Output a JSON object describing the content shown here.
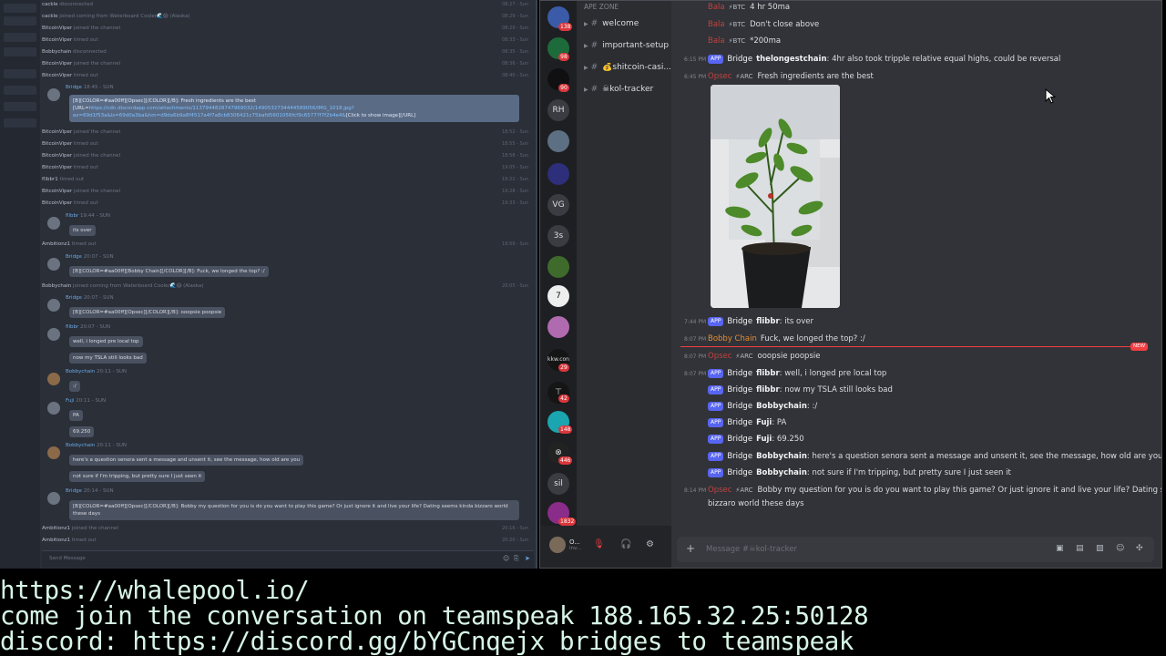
{
  "left": {
    "rows": [
      {
        "name": "cackle",
        "action": "disconnected",
        "time": "08:27 - Sun"
      },
      {
        "name": "cackle",
        "action": "joined coming from Waterboard Cooler🌊😱 (Alaska)",
        "time": "08:29 - Sun"
      },
      {
        "name": "BitcoinViper",
        "action": "joined the channel",
        "time": "08:29 - Sun"
      },
      {
        "name": "BitcoinViper",
        "action": "timed out",
        "time": "08:33 - Sun"
      },
      {
        "name": "Bobbychain",
        "action": "disconnected",
        "time": "08:35 - Sun"
      },
      {
        "name": "BitcoinViper",
        "action": "joined the channel",
        "time": "08:36 - Sun"
      },
      {
        "name": "BitcoinViper",
        "action": "timed out",
        "time": "08:40 - Sun"
      }
    ],
    "rows2": [
      {
        "name": "BitcoinViper",
        "action": "joined the channel",
        "time": "18:52 - Sun"
      },
      {
        "name": "BitcoinViper",
        "action": "timed out",
        "time": "18:55 - Sun"
      },
      {
        "name": "BitcoinViper",
        "action": "joined the channel",
        "time": "18:58 - Sun"
      },
      {
        "name": "BitcoinViper",
        "action": "timed out",
        "time": "19:05 - Sun"
      },
      {
        "name": "flibbr1",
        "action": "timed out",
        "time": "19:22 - Sun"
      },
      {
        "name": "BitcoinViper",
        "action": "joined the channel",
        "time": "19:28 - Sun"
      },
      {
        "name": "BitcoinViper",
        "action": "timed out",
        "time": "19:33 - Sun"
      }
    ],
    "bridge1_author": "Bridge",
    "bridge1_time": "18:45 - SUN",
    "bridge1_line1": "[B][COLOR=#aa00ff][Opsec][/COLOR][/B]: Fresh ingredients are the best",
    "bridge1_line2a": "[URL=",
    "bridge1_line2b": "https://cdn.discordapp.com/attachments/1137944828747969032/1490532734444589056/IMG_1018.jpg?",
    "bridge1_line3": "ex=69d1f53a&is=69d0a3ba&hm=d9da6b9a8f4517a4f7a8cb8306421c75bafd5601056fcf9c6577?f7f2b4e4&",
    "bridge1_line3b": "[Click to show image]",
    "bridge1_line3c": "[/URL]",
    "flibbr_author": "flibbr",
    "flibbr_time": "19:44 - SUN",
    "flibbr_msg": "its over",
    "amb_row": {
      "name": "Ambitionz1",
      "action": "timed out",
      "time": "19:59 - Sun"
    },
    "bridge2_author": "Bridge",
    "bridge2_time": "20:07 - SUN",
    "bridge2_msg": "[B][COLOR=#aa00ff][Bobby Chain][/COLOR][/B]: Fuck, we longed the top? :/",
    "bobby_row": {
      "name": "Bobbychain",
      "action": "joined coming from Waterboard Cooler🌊😱 (Alaska)",
      "time": "20:05 - Sun"
    },
    "bridge3_author": "Bridge",
    "bridge3_time": "20:07 - SUN",
    "bridge3_msg": "[B][COLOR=#aa00ff][Opsec][/COLOR][/B]: ooopsie poopsie",
    "flibbr2_author": "flibbr",
    "flibbr2_time": "20:07 - SUN",
    "flibbr2_msg1": "well, i longed pre local top",
    "flibbr2_msg2": "now my TSLA still looks bad",
    "bc1_author": "Bobbychain",
    "bc1_time": "20:11 - SUN",
    "bc1_msg": ":/",
    "fuji_author": "Fuji",
    "fuji_time": "20:11 - SUN",
    "fuji_msg1": "PA",
    "fuji_msg2": "69.250",
    "bc2_author": "Bobbychain",
    "bc2_time": "20:11 - SUN",
    "bc2_msg1": "here's a question senora sent a message and unsent it, see the message, how old are you",
    "bc2_msg2": "not sure if I'm tripping, but pretty sure I just seen it",
    "bridge4_author": "Bridge",
    "bridge4_time": "20:14 - SUN",
    "bridge4_msg": "[B][COLOR=#aa00ff][Opsec][/COLOR][/B]: Bobby my question for you is do you want to play this game? Or just ignore it and live your life? Dating seems kinda bizzaro world these days",
    "tail_rows": [
      {
        "name": "Ambitionz1",
        "action": "joined the channel",
        "time": "20:16 - Sun"
      },
      {
        "name": "Ambitionz1",
        "action": "timed out",
        "time": "20:20 - Sun"
      }
    ],
    "input_placeholder": "Send Message"
  },
  "right": {
    "zone": "APE ZONE",
    "channels": [
      {
        "name": "welcome",
        "icon": "hash"
      },
      {
        "name": "important-setup",
        "icon": "hash"
      },
      {
        "name": "💰shitcoin-casi...",
        "icon": "hash"
      },
      {
        "name": "☠kol-tracker",
        "icon": "hash"
      }
    ],
    "servers": [
      {
        "label": "",
        "badge": "138"
      },
      {
        "label": "",
        "badge": "98"
      },
      {
        "label": "",
        "badge": "90"
      },
      {
        "label": "RH",
        "badge": ""
      },
      {
        "label": "",
        "badge": ""
      },
      {
        "label": "",
        "badge": ""
      },
      {
        "label": "VG",
        "badge": ""
      },
      {
        "label": "3s",
        "badge": ""
      },
      {
        "label": "",
        "badge": ""
      },
      {
        "label": "7",
        "badge": ""
      },
      {
        "label": "",
        "badge": ""
      },
      {
        "label": "",
        "badge": "29"
      },
      {
        "label": "",
        "badge": "42"
      },
      {
        "label": "",
        "badge": "148"
      },
      {
        "label": "",
        "badge": "446"
      },
      {
        "label": "sil",
        "badge": ""
      },
      {
        "label": "",
        "badge": "1832"
      }
    ],
    "user_name": "O...",
    "user_status": "inv...",
    "messages": {
      "a1": {
        "user": "Bala",
        "tag": "⚡BTC",
        "text": "4 hr 50ma"
      },
      "a2": {
        "user": "Bala",
        "tag": "⚡BTC",
        "text": "Don't close above"
      },
      "a3": {
        "user": "Bala",
        "tag": "⚡BTC",
        "text": "*200ma"
      },
      "b1": {
        "time": "6:15 PM",
        "app": "APP",
        "bridge": "Bridge",
        "name": "thelongestchain",
        "text": ": 4hr also took tripple relative equal highs, could be reversal"
      },
      "c1": {
        "time": "6:45 PM",
        "user": "Opsec",
        "tag": "⚡ARC",
        "text": "Fresh ingredients are the best"
      },
      "d1": {
        "time": "7:44 PM",
        "app": "APP",
        "bridge": "Bridge",
        "name": "flibbr",
        "text": ": its over"
      },
      "e1": {
        "time": "8:07 PM",
        "user": "Bobby Chain",
        "text": "Fuck, we longed the top? :/"
      },
      "f1": {
        "time": "8:07 PM",
        "user": "Opsec",
        "tag": "⚡ARC",
        "text": "ooopsie poopsie"
      },
      "g1": {
        "time": "8:07 PM",
        "app": "APP",
        "bridge": "Bridge",
        "name": "flibbr",
        "text": ": well, i longed pre local top"
      },
      "g2": {
        "app": "APP",
        "bridge": "Bridge",
        "name": "flibbr",
        "text": ": now my TSLA still looks bad"
      },
      "g3": {
        "app": "APP",
        "bridge": "Bridge",
        "name": "Bobbychain",
        "text": ": :/"
      },
      "g4": {
        "app": "APP",
        "bridge": "Bridge",
        "name": "Fuji",
        "text": ": PA"
      },
      "g5": {
        "app": "APP",
        "bridge": "Bridge",
        "name": "Fuji",
        "text": ": 69.250"
      },
      "g6": {
        "app": "APP",
        "bridge": "Bridge",
        "name": "Bobbychain",
        "text": ": here's a question senora sent a message and unsent it, see the message, how old are you"
      },
      "g7": {
        "app": "APP",
        "bridge": "Bridge",
        "name": "Bobbychain",
        "text": ": not sure if I'm tripping, but pretty sure I just seen it"
      },
      "h1": {
        "time": "8:14 PM",
        "user": "Opsec",
        "tag": "⚡ARC",
        "text": "Bobby my question for you is do you want to play this game? Or just ignore it and live your life? Dating seems kinda",
        "text2": "bizzaro world these days"
      }
    },
    "new_badge": "NEW",
    "composer_placeholder": "Message #☠kol-tracker"
  },
  "banner": {
    "line1": "https://whalepool.io/",
    "line2": "come join the conversation on teamspeak 188.165.32.25:50128",
    "line3": "discord: https://discord.gg/bYGCnqejx bridges to teamspeak"
  }
}
